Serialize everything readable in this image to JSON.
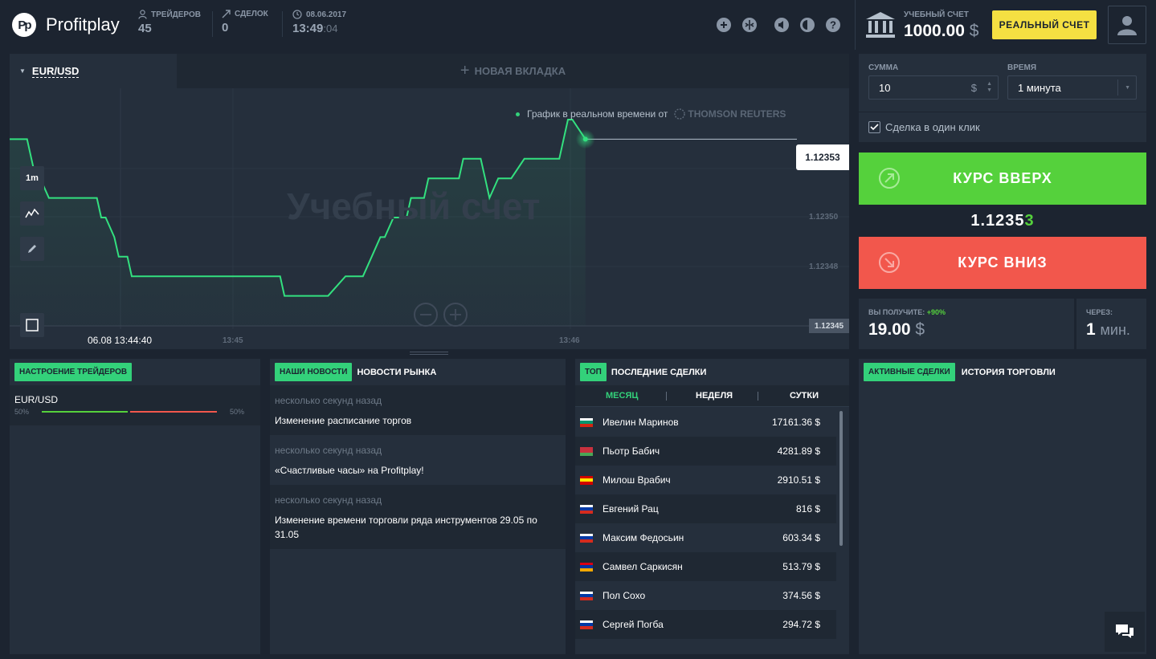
{
  "header": {
    "logo_text": "Profitplay",
    "logo_mark": "Pp",
    "traders_label": "ТРЕЙДЕРОВ",
    "traders_value": "45",
    "deals_label": "СДЕЛОК",
    "deals_value": "0",
    "date": "08.06.2017",
    "time_hm": "13:49",
    "time_sec": ":04",
    "account_label": "УЧЕБНЫЙ СЧЕТ",
    "account_balance": "1000.00",
    "account_currency": "$",
    "real_account_button": "РЕАЛЬНЫЙ СЧЕТ",
    "icons": [
      "gamepad-icon",
      "split-icon",
      "sound-icon",
      "contrast-icon",
      "help-icon"
    ]
  },
  "chart": {
    "tab_pair": "EUR/USD",
    "new_tab_label": "НОВАЯ ВКЛАДКА",
    "realtime_label": "График в реальном времени от",
    "provider": "THOMSON REUTERS",
    "watermark": "Учебный счет",
    "timeframe": "1m",
    "current_price": "1.12353",
    "low_price_tag": "1.12345",
    "y_ticks": [
      "1.12350",
      "1.12348"
    ],
    "x_start_label": "06.08 13:44:40",
    "x_ticks": [
      "13:45",
      "13:46"
    ],
    "colors": {
      "line": "#33e07f",
      "background": "#252f3c"
    },
    "chart_data": {
      "type": "line",
      "ylim": [
        1.12345,
        1.12355
      ],
      "x": [
        0,
        4,
        5,
        6,
        7,
        9,
        10,
        13,
        20,
        21,
        22,
        24,
        25,
        27,
        28,
        30,
        33,
        39,
        60,
        62,
        63,
        68,
        69,
        73,
        77,
        78,
        79,
        81,
        83,
        85,
        86,
        88,
        90,
        91,
        92,
        93,
        95,
        96,
        98,
        103,
        104,
        108,
        109,
        110,
        112,
        115,
        118,
        119,
        126,
        127,
        128,
        129,
        132
      ],
      "y": [
        1.12354,
        1.12354,
        1.12353,
        1.12352,
        1.12352,
        1.12351,
        1.12351,
        1.12351,
        1.12351,
        1.1235,
        1.1235,
        1.12349,
        1.12348,
        1.12348,
        1.12347,
        1.12347,
        1.12347,
        1.12347,
        1.12347,
        1.12347,
        1.12346,
        1.12346,
        1.12346,
        1.12346,
        1.12347,
        1.12347,
        1.12347,
        1.12347,
        1.12348,
        1.12349,
        1.12349,
        1.1235,
        1.1235,
        1.1235,
        1.12351,
        1.12351,
        1.12351,
        1.12352,
        1.12352,
        1.12352,
        1.12353,
        1.12353,
        1.12352,
        1.12351,
        1.12352,
        1.12352,
        1.12353,
        1.12353,
        1.12353,
        1.12354,
        1.12355,
        1.12355,
        1.12354
      ]
    }
  },
  "trade": {
    "amount_label": "СУММА",
    "amount_value": "10",
    "amount_currency": "$",
    "time_label": "ВРЕМЯ",
    "time_value": "1 минута",
    "one_click_label": "Сделка в один клик",
    "up_label": "КУРС ВВЕРХ",
    "down_label": "КУРС ВНИЗ",
    "price_main": "1.1235",
    "price_last": "3",
    "payout_label": "ВЫ ПОЛУЧИТЕ:",
    "payout_pct": "+90%",
    "payout_value": "19.00",
    "payout_currency": "$",
    "expiry_label": "ЧЕРЕЗ:",
    "expiry_value": "1",
    "expiry_unit": "мин."
  },
  "sentiment": {
    "title": "НАСТРОЕНИЕ ТРЕЙДЕРОВ",
    "pair": "EUR/USD",
    "buy_pct_label": "50%",
    "sell_pct_label": "50%",
    "buy_fraction": 0.5,
    "colors": {
      "buy": "#55d13c",
      "sell": "#f2574c"
    }
  },
  "news": {
    "tab_active": "НАШИ НОВОСТИ",
    "tab_other": "НОВОСТИ РЫНКА",
    "items": [
      {
        "time": "несколько секунд назад",
        "title": "Изменение расписание торгов"
      },
      {
        "time": "несколько секунд назад",
        "title": "«Счастливые часы» на Profitplay!"
      },
      {
        "time": "несколько секунд назад",
        "title": "Изменение времени торговли ряда инструментов 29.05 по 31.05"
      }
    ]
  },
  "top": {
    "tab_active": "ТОП",
    "tab_other": "ПОСЛЕДНИЕ СДЕЛКИ",
    "periods": [
      "МЕСЯЦ",
      "НЕДЕЛЯ",
      "СУТКИ"
    ],
    "traders": [
      {
        "name": "Ивелин Маринов",
        "amount": "17161.36 $",
        "flag": [
          "#ffffff",
          "#00966e",
          "#d62612"
        ]
      },
      {
        "name": "Пьотр Бабич",
        "amount": "4281.89 $",
        "flag": [
          "#c8313e",
          "#c8313e",
          "#4aa657"
        ]
      },
      {
        "name": "Милош Врабич",
        "amount": "2910.51 $",
        "flag": [
          "#d20000",
          "#ffe600",
          "#d20000"
        ]
      },
      {
        "name": "Евгений Рац",
        "amount": "816 $",
        "flag": [
          "#ffffff",
          "#0039a6",
          "#d52b1e"
        ]
      },
      {
        "name": "Максим Федосьин",
        "amount": "603.34 $",
        "flag": [
          "#ffffff",
          "#0039a6",
          "#d52b1e"
        ]
      },
      {
        "name": "Самвел Саркисян",
        "amount": "513.79 $",
        "flag": [
          "#d90012",
          "#0033a0",
          "#f2a800"
        ]
      },
      {
        "name": "Пол Сохо",
        "amount": "374.56 $",
        "flag": [
          "#ffffff",
          "#0039a6",
          "#d52b1e"
        ]
      },
      {
        "name": "Сергей Погба",
        "amount": "294.72 $",
        "flag": [
          "#ffffff",
          "#0039a6",
          "#d52b1e"
        ]
      }
    ]
  },
  "active": {
    "tab_active": "АКТИВНЫЕ СДЕЛКИ",
    "tab_other": "ИСТОРИЯ ТОРГОВЛИ"
  }
}
